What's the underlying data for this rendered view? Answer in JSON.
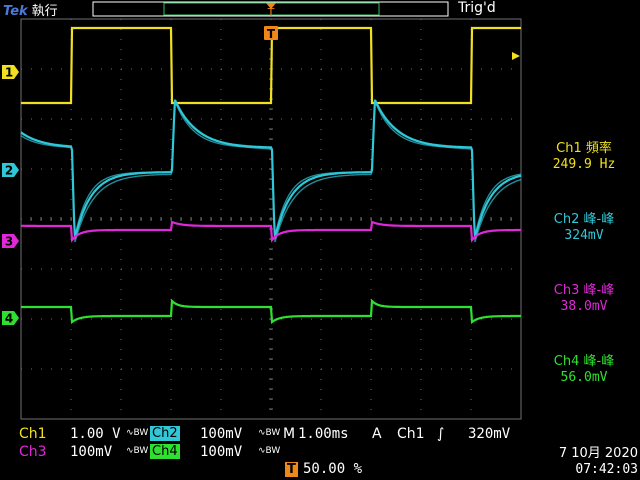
{
  "header": {
    "brand": "Tek",
    "run_state": "執行",
    "trigger_state": "Trig'd"
  },
  "colors": {
    "ch1": "#f0e020",
    "ch2": "#30c8d8",
    "ch3": "#e028d8",
    "ch4": "#30e030",
    "marker": "#f08818",
    "grid": "#707070"
  },
  "channels": [
    {
      "id": "ch1",
      "marker": "1"
    },
    {
      "id": "ch2",
      "marker": "2"
    },
    {
      "id": "ch3",
      "marker": "3"
    },
    {
      "id": "ch4",
      "marker": "4"
    }
  ],
  "trigger_marker": "T",
  "measurements": [
    {
      "label": "Ch1 頻率",
      "value": "249.9 Hz"
    },
    {
      "label": "Ch2 峰-峰",
      "value": "324mV"
    },
    {
      "label": "Ch3 峰-峰",
      "value": "38.0mV"
    },
    {
      "label": "Ch4 峰-峰",
      "value": "56.0mV"
    }
  ],
  "status": {
    "ch1_name": "Ch1",
    "ch1_scale": "1.00 V",
    "ch2_name": "Ch2",
    "ch2_scale": "100mV",
    "ch3_name": "Ch3",
    "ch3_scale": "100mV",
    "ch4_name": "Ch4",
    "ch4_scale": "100mV",
    "bw_symbol": "∿BW",
    "timebase_prefix": "M",
    "timebase": "1.00ms",
    "trigger_mode": "A",
    "trigger_source": "Ch1",
    "trigger_slope": "∫",
    "trigger_level": "320mV",
    "trigger_position_marker": "T",
    "trigger_position": "50.00 %",
    "date": "7 10月 2020",
    "time": "07:42:03"
  }
}
